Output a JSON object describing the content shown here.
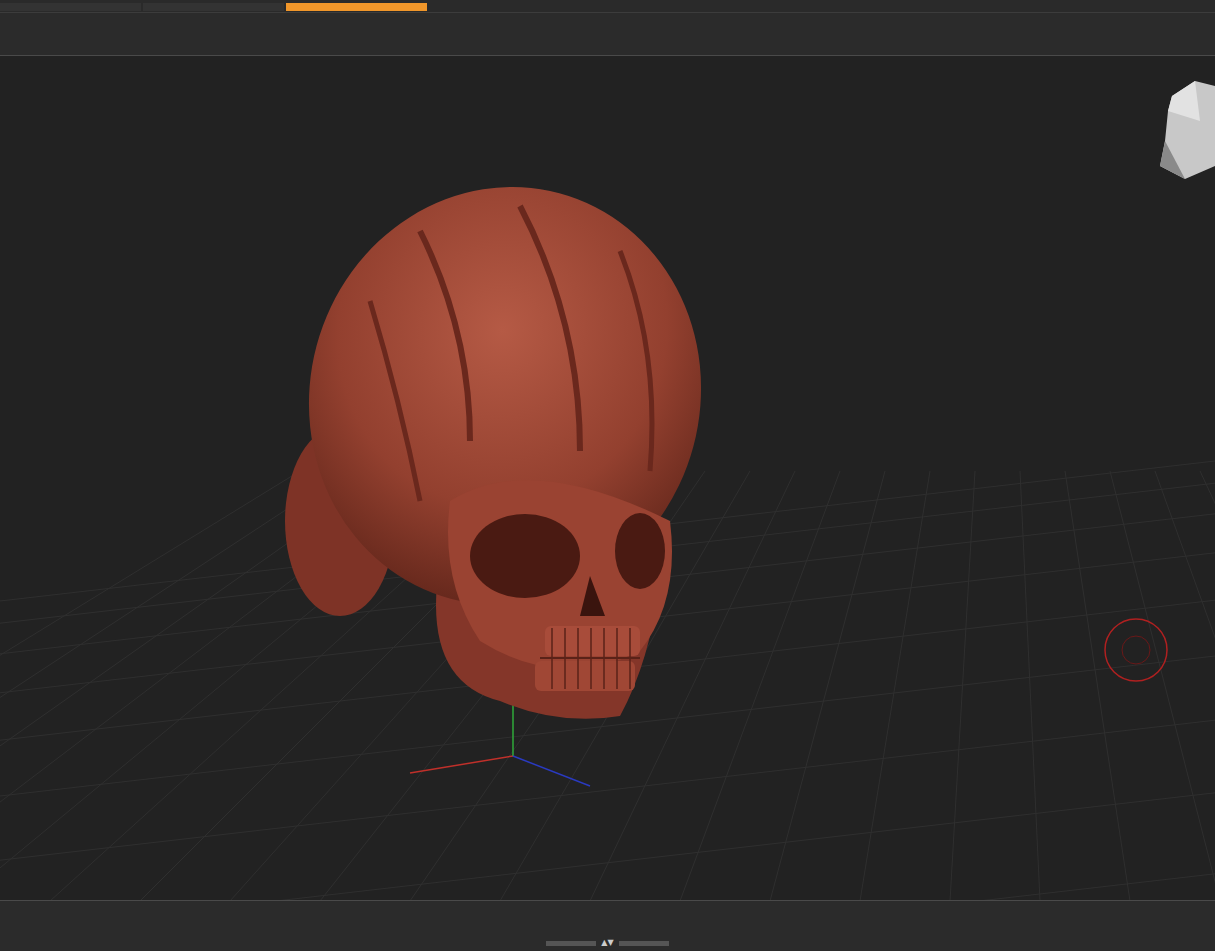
{
  "header": {
    "segments": [
      {
        "selected": false
      },
      {
        "selected": false
      },
      {
        "selected": true
      }
    ]
  },
  "viewport": {
    "gizmo_axes": [
      {
        "axis": "x",
        "color": "#c0302a"
      },
      {
        "axis": "y",
        "color": "#2faa3a"
      },
      {
        "axis": "z",
        "color": "#2a3ac0"
      }
    ]
  },
  "bottom_bar": {
    "handle": "▲▼"
  }
}
